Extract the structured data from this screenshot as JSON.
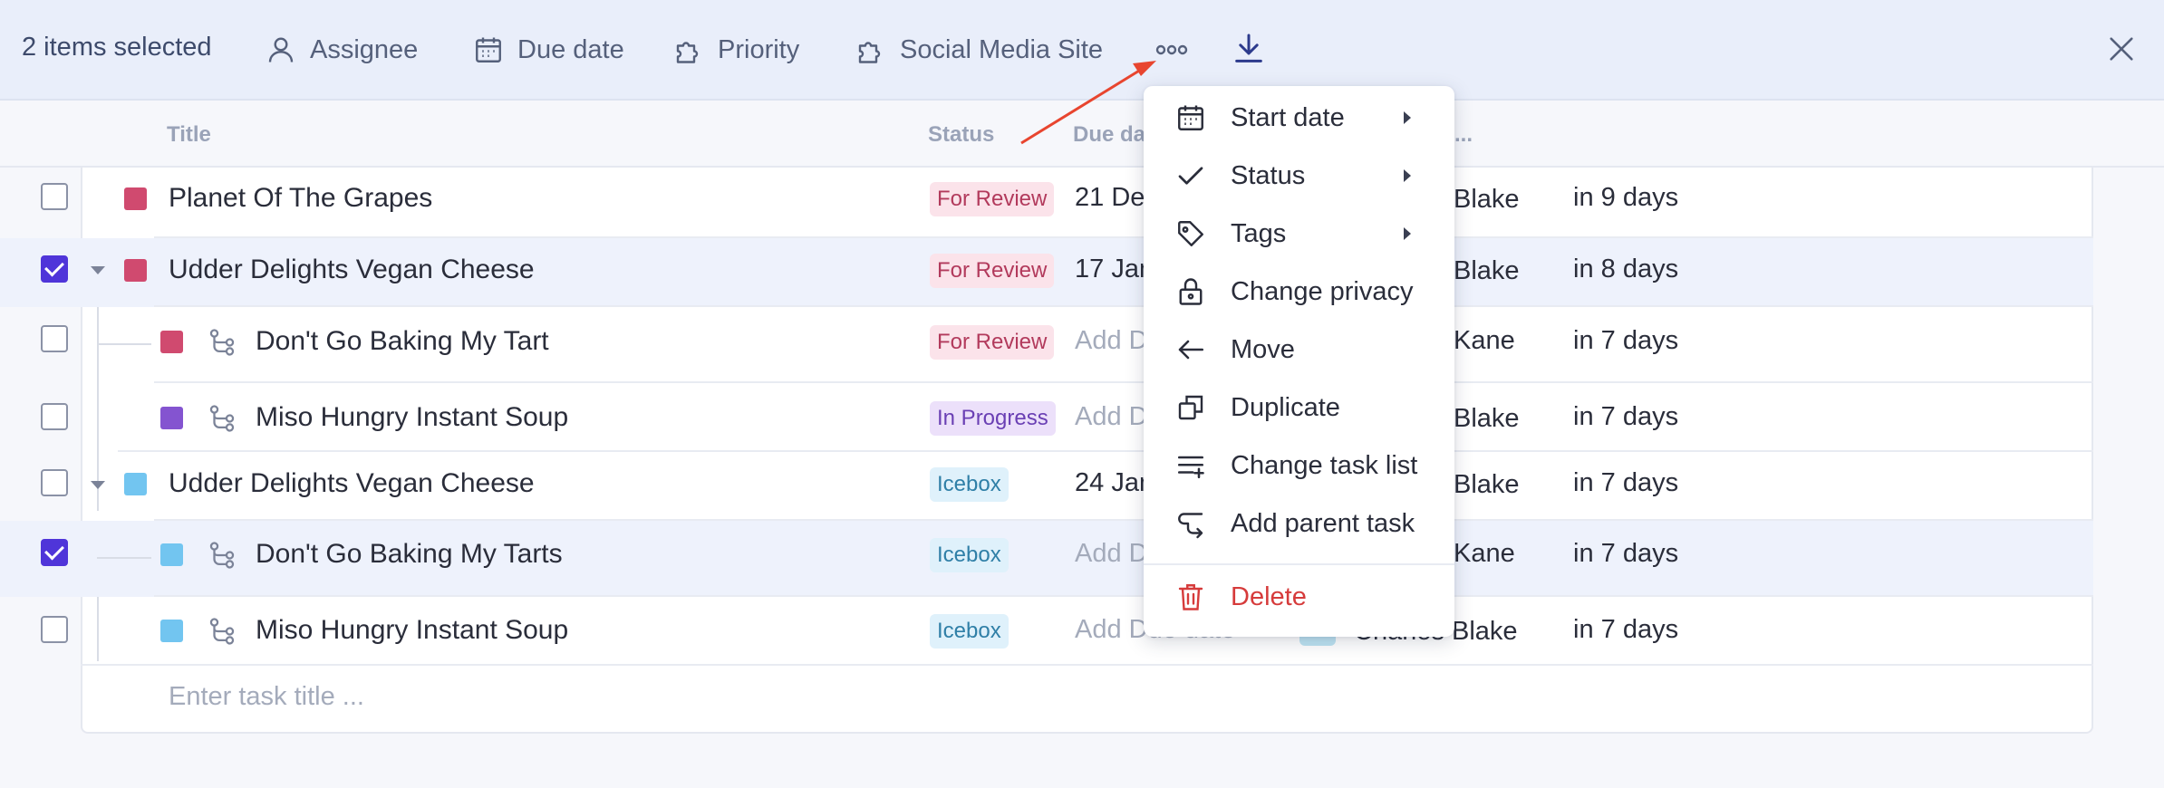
{
  "toolbar": {
    "selection_count": "2 items selected",
    "actions": [
      {
        "label": "Assignee",
        "icon": "person-icon"
      },
      {
        "label": "Due date",
        "icon": "calendar-icon"
      },
      {
        "label": "Priority",
        "icon": "puzzle-icon"
      },
      {
        "label": "Social Media Site",
        "icon": "puzzle-icon"
      }
    ],
    "more_icon": "more-horizontal-icon",
    "download_icon": "download-icon",
    "close_icon": "close-icon"
  },
  "columns": {
    "title": "Title",
    "status": "Status",
    "due": "Due da",
    "extra": "..."
  },
  "rows": [
    {
      "checked": false,
      "color": "#d04a6f",
      "title": "Planet Of The Grapes",
      "status": "For Review",
      "status_style": "review",
      "due": "21 De",
      "assignee": "Blake",
      "relative": "in 9 days"
    },
    {
      "checked": true,
      "color": "#d04a6f",
      "title": "Udder Delights Vegan Cheese",
      "status": "For Review",
      "status_style": "review",
      "due": "17 Jan",
      "assignee": "Blake",
      "relative": "in 8 days"
    },
    {
      "checked": false,
      "color": "#d04a6f",
      "title": "Don't Go Baking My Tart",
      "status": "For Review",
      "status_style": "review",
      "due": "Add D",
      "assignee": "Kane",
      "relative": "in 7 days"
    },
    {
      "checked": false,
      "color": "#8454d0",
      "title": "Miso Hungry Instant Soup",
      "status": "In Progress",
      "status_style": "progress",
      "due": "Add D",
      "assignee": "Blake",
      "relative": "in 7 days"
    },
    {
      "checked": false,
      "color": "#72c5f0",
      "title": "Udder Delights Vegan Cheese",
      "status": "Icebox",
      "status_style": "icebox",
      "due": "24 Jan",
      "assignee": "Blake",
      "relative": "in 7 days"
    },
    {
      "checked": true,
      "color": "#72c5f0",
      "title": "Don't Go Baking My Tarts",
      "status": "Icebox",
      "status_style": "icebox",
      "due": "Add D",
      "assignee": "Kane",
      "relative": "in 7 days"
    },
    {
      "checked": false,
      "color": "#72c5f0",
      "title": "Miso Hungry Instant Soup",
      "status": "Icebox",
      "status_style": "icebox",
      "due": "Add Due date",
      "assignee": "Charles Blake",
      "relative": "in 7 days"
    }
  ],
  "new_task_placeholder": "Enter task title ...",
  "menu": {
    "items": [
      {
        "label": "Start date",
        "icon": "calendar-icon",
        "submenu": true
      },
      {
        "label": "Status",
        "icon": "check-icon",
        "submenu": true
      },
      {
        "label": "Tags",
        "icon": "tag-icon",
        "submenu": true
      },
      {
        "label": "Change privacy",
        "icon": "lock-icon",
        "submenu": false
      },
      {
        "label": "Move",
        "icon": "arrow-left-icon",
        "submenu": false
      },
      {
        "label": "Duplicate",
        "icon": "duplicate-icon",
        "submenu": false
      },
      {
        "label": "Change task list",
        "icon": "list-add-icon",
        "submenu": false
      },
      {
        "label": "Add parent task",
        "icon": "parent-task-icon",
        "submenu": false
      }
    ],
    "delete_label": "Delete"
  },
  "colors": {
    "accent": "#4f35d9",
    "danger": "#d63b3b",
    "annotation_arrow": "#e8452f"
  }
}
